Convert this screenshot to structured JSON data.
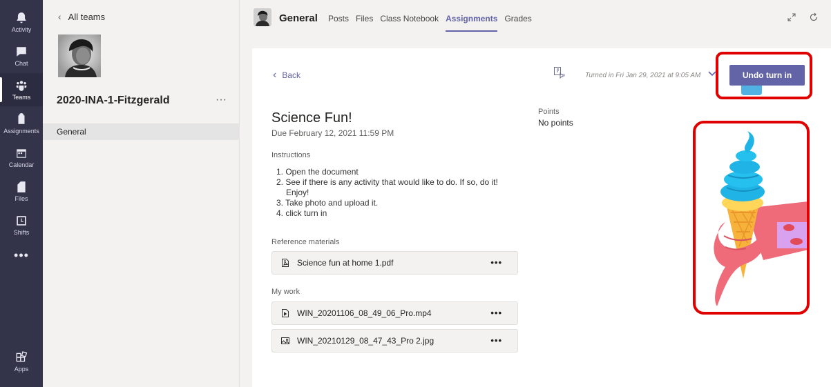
{
  "rail": {
    "items": [
      {
        "label": "Activity",
        "icon": "bell-icon"
      },
      {
        "label": "Chat",
        "icon": "chat-icon"
      },
      {
        "label": "Teams",
        "icon": "teams-icon"
      },
      {
        "label": "Assignments",
        "icon": "assignments-icon"
      },
      {
        "label": "Calendar",
        "icon": "calendar-icon"
      },
      {
        "label": "Files",
        "icon": "files-icon"
      },
      {
        "label": "Shifts",
        "icon": "shifts-icon"
      },
      {
        "label": "Apps",
        "icon": "apps-icon"
      }
    ],
    "more": "•••"
  },
  "sidebar": {
    "back_label": "All teams",
    "team_name": "2020-INA-1-Fitzgerald",
    "more": "···",
    "channel": "General"
  },
  "header": {
    "channel_title": "General",
    "tabs": [
      "Posts",
      "Files",
      "Class Notebook",
      "Assignments",
      "Grades"
    ],
    "active_tab": "Assignments"
  },
  "assignment": {
    "back_label": "Back",
    "turnin_status": "Turned in Fri Jan 29, 2021 at 9:05 AM",
    "undo_label": "Undo turn in",
    "title": "Science Fun!",
    "due": "Due February 12, 2021 11:59 PM",
    "points_label": "Points",
    "points_value": "No points",
    "instructions_label": "Instructions",
    "instructions": [
      "1. Open the document",
      "2. See if there is any activity that would like to do. If so, do it!",
      "Enjoy!",
      "3. Take photo and upload it.",
      "4. click turn in"
    ],
    "reference_label": "Reference materials",
    "reference_files": [
      {
        "name": "Science fun at home 1.pdf",
        "icon": "pdf-file-icon"
      }
    ],
    "mywork_label": "My work",
    "mywork_files": [
      {
        "name": "WIN_20201106_08_49_06_Pro.mp4",
        "icon": "video-file-icon"
      },
      {
        "name": "WIN_20210129_08_47_43_Pro 2.jpg",
        "icon": "image-file-icon"
      }
    ],
    "more_dots": "•••"
  },
  "colors": {
    "accent": "#6264a7",
    "rail": "#33344a",
    "highlight": "#e00000"
  }
}
